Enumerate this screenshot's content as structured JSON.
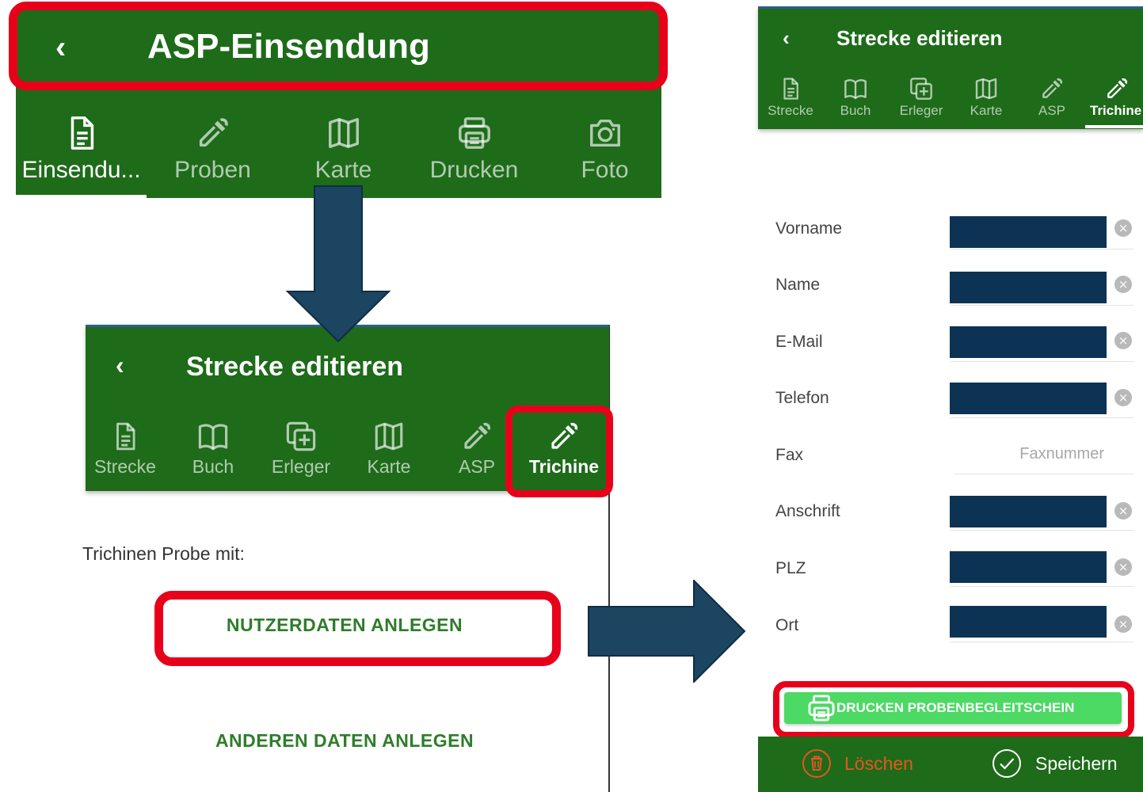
{
  "screen1": {
    "title": "ASP-Einsendung",
    "tabs": [
      {
        "label": "Einsendu...",
        "icon": "document-icon"
      },
      {
        "label": "Proben",
        "icon": "pipette-icon"
      },
      {
        "label": "Karte",
        "icon": "map-icon"
      },
      {
        "label": "Drucken",
        "icon": "printer-icon"
      },
      {
        "label": "Foto",
        "icon": "camera-icon"
      }
    ]
  },
  "screen2": {
    "title": "Strecke editieren",
    "tabs": [
      {
        "label": "Strecke",
        "icon": "document-icon"
      },
      {
        "label": "Buch",
        "icon": "book-icon"
      },
      {
        "label": "Erleger",
        "icon": "add-copy-icon"
      },
      {
        "label": "Karte",
        "icon": "map-icon"
      },
      {
        "label": "ASP",
        "icon": "pipette-icon"
      },
      {
        "label": "Trichine",
        "icon": "pipette-icon"
      }
    ],
    "section_label": "Trichinen Probe mit:",
    "btn_user": "NUTZERDATEN ANLEGEN",
    "btn_other": "ANDEREN DATEN ANLEGEN"
  },
  "screen3": {
    "title": "Strecke editieren",
    "tabs": [
      {
        "label": "Strecke",
        "icon": "document-icon"
      },
      {
        "label": "Buch",
        "icon": "book-icon"
      },
      {
        "label": "Erleger",
        "icon": "add-copy-icon"
      },
      {
        "label": "Karte",
        "icon": "map-icon"
      },
      {
        "label": "ASP",
        "icon": "pipette-icon"
      },
      {
        "label": "Trichine",
        "icon": "pipette-icon"
      }
    ],
    "fields": [
      {
        "label": "Vorname"
      },
      {
        "label": "Name"
      },
      {
        "label": "E-Mail"
      },
      {
        "label": "Telefon"
      },
      {
        "label": "Fax",
        "placeholder": "Faxnummer"
      },
      {
        "label": "Anschrift"
      },
      {
        "label": "PLZ"
      },
      {
        "label": "Ort"
      }
    ],
    "print_button": "DRUCKEN PROBENBEGLEITSCHEIN",
    "delete_button": "Löschen",
    "save_button": "Speichern"
  },
  "colors": {
    "app_green": "#1e6b1a",
    "highlight_red": "#e8001b",
    "arrow_blue": "#1c4562",
    "redaction": "#0c3353",
    "button_green": "#4cd964",
    "delete_orange": "#e8551f"
  }
}
